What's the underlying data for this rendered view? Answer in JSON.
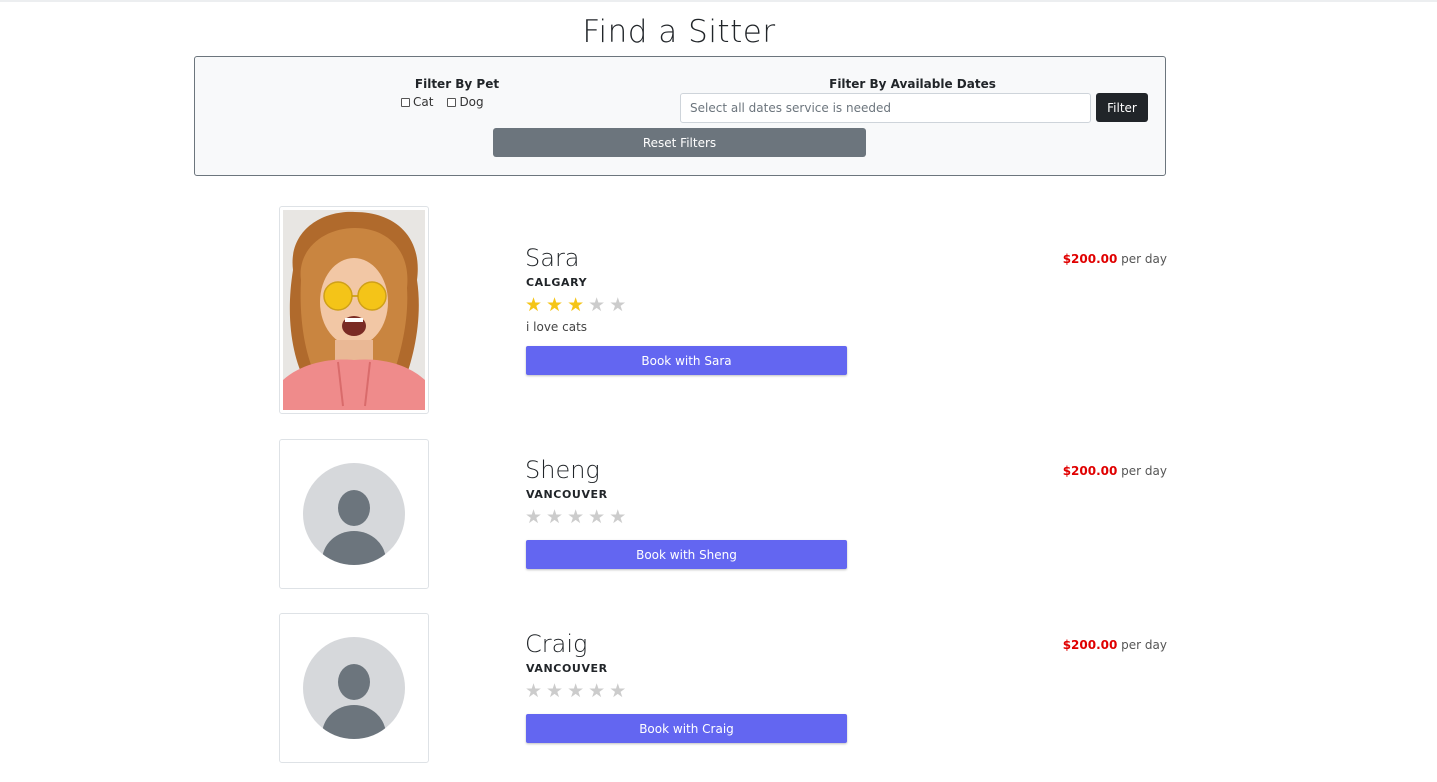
{
  "page": {
    "title": "Find a Sitter"
  },
  "filters": {
    "pet_heading": "Filter By Pet",
    "pet_options": [
      {
        "label": "Cat",
        "checked": false
      },
      {
        "label": "Dog",
        "checked": false
      }
    ],
    "dates_heading": "Filter By Available Dates",
    "dates_placeholder": "Select all dates service is needed",
    "filter_label": "Filter",
    "reset_label": "Reset Filters"
  },
  "colors": {
    "accent": "#6366f1",
    "price": "#e00000",
    "star_filled": "#f5c518",
    "star_empty": "#cccccc"
  },
  "sitters": [
    {
      "name": "Sara",
      "city": "CALGARY",
      "rating": 3,
      "max_rating": 5,
      "bio": "i love cats",
      "price": "$200.00",
      "price_unit": "per day",
      "book_label": "Book with Sara",
      "photo": "woman-portrait"
    },
    {
      "name": "Sheng",
      "city": "VANCOUVER",
      "rating": 0,
      "max_rating": 5,
      "bio": "",
      "price": "$200.00",
      "price_unit": "per day",
      "book_label": "Book with Sheng",
      "photo": "avatar-placeholder-icon"
    },
    {
      "name": "Craig",
      "city": "VANCOUVER",
      "rating": 0,
      "max_rating": 5,
      "bio": "",
      "price": "$200.00",
      "price_unit": "per day",
      "book_label": "Book with Craig",
      "photo": "avatar-placeholder-icon"
    }
  ]
}
